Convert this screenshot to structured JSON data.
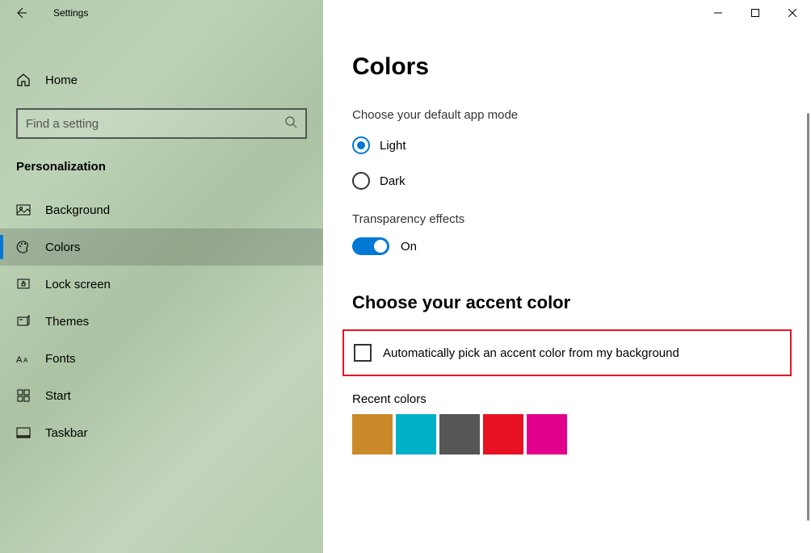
{
  "window": {
    "title": "Settings"
  },
  "sidebar": {
    "home": "Home",
    "search_placeholder": "Find a setting",
    "category": "Personalization",
    "items": [
      {
        "label": "Background"
      },
      {
        "label": "Colors"
      },
      {
        "label": "Lock screen"
      },
      {
        "label": "Themes"
      },
      {
        "label": "Fonts"
      },
      {
        "label": "Start"
      },
      {
        "label": "Taskbar"
      }
    ]
  },
  "main": {
    "title": "Colors",
    "app_mode_label": "Choose your default app mode",
    "light": "Light",
    "dark": "Dark",
    "transparency_label": "Transparency effects",
    "toggle_state": "On",
    "accent_title": "Choose your accent color",
    "auto_pick": "Automatically pick an accent color from my background",
    "recent_label": "Recent colors",
    "recent_colors": [
      "#ca8a2a",
      "#00b0c7",
      "#565656",
      "#e81123",
      "#e3008c"
    ]
  }
}
